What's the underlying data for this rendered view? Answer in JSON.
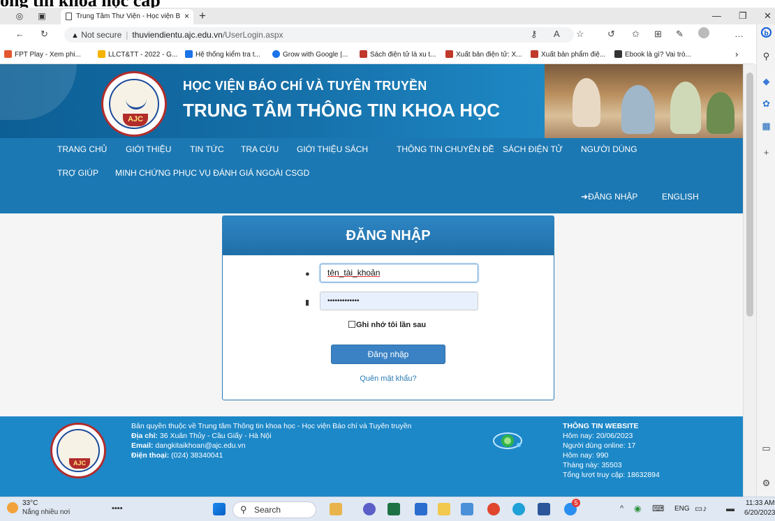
{
  "cropped_heading": "ông tin khoa học cấp",
  "browser": {
    "tab_title": "Trung Tâm Thư Viện - Học viện B",
    "tab_close": "×",
    "new_tab": "+",
    "address": {
      "security": "Not secure",
      "host": "thuviendientu.ajc.edu.vn",
      "path": "/UserLogin.aspx"
    },
    "bookmarks": [
      {
        "label": "FPT Play - Xem phi...",
        "color": "#e4572e"
      },
      {
        "label": "LLCT&TT - 2022 - G...",
        "color": "#1a73e8"
      },
      {
        "label": "Hệ thống kiểm tra t...",
        "color": "#1a73e8"
      },
      {
        "label": "Grow with Google |...",
        "color": "#1a73e8"
      },
      {
        "label": "Sách điện tử là xu t...",
        "color": "#c0392b"
      },
      {
        "label": "Xuất bản điện tử: X...",
        "color": "#c0392b"
      },
      {
        "label": "Xuất bản phẩm điệ...",
        "color": "#c0392b"
      },
      {
        "label": "Ebook là gì? Vai trò...",
        "color": "#333333"
      }
    ]
  },
  "site": {
    "header_line1": "HỌC VIỆN BÁO CHÍ VÀ TUYÊN TRUYỀN",
    "header_line2": "TRUNG TÂM THÔNG TIN KHOA HỌC",
    "logo_text": "AJC",
    "nav": [
      "TRANG CHỦ",
      "GIỚI THIỆU",
      "TIN TỨC",
      "TRA CỨU",
      "GIỚI THIỆU SÁCH",
      "THÔNG TIN CHUYÊN ĐỀ",
      "SÁCH ĐIỆN TỬ",
      "NGƯỜI DÙNG",
      "TRỢ GIÚP",
      "MINH CHỨNG PHỤC VỤ ĐÁNH GIÁ NGOÀI CSGD"
    ],
    "login_link": "ĐĂNG NHẬP",
    "english_link": "ENGLISH"
  },
  "login": {
    "title": "ĐĂNG NHẬP",
    "username_value": "tên_tài_khoản",
    "password_value": "•••••••••••••",
    "remember_label": "Ghi nhớ tôi lần sau",
    "submit_label": "Đăng nhập",
    "forgot_label": "Quên mật khẩu?"
  },
  "footer": {
    "copyright": "Bản quyền thuộc về Trung tâm Thông tin khoa học - Học viện Báo chí và Tuyên truyền",
    "address_label": "Địa chỉ:",
    "address_value": " 36 Xuân Thủy - Cầu Giấy - Hà Nội",
    "email_label": "Email:",
    "email_value": " dangkitaikhoan@ajc.edu.vn",
    "phone_label": "Điện thoại:",
    "phone_value": " (024) 38340041",
    "stats_title": "THÔNG TIN WEBSITE",
    "stats": [
      "Hôm nay: 20/06/2023",
      "Người dùng online: 17",
      "Hôm nay: 990",
      "Tháng này: 35503",
      "Tổng lượt truy cập: 18632894"
    ]
  },
  "taskbar": {
    "weather_temp": "33°C",
    "weather_desc": "Nắng nhiều nơi",
    "search_label": "Search",
    "lang": "ENG",
    "time": "11:33 AM",
    "date": "6/20/2023",
    "badge": "5"
  },
  "colors": {
    "nav_blue": "#1c78b3",
    "footer_blue": "#1d88c8",
    "accent": "#3a82c4"
  }
}
